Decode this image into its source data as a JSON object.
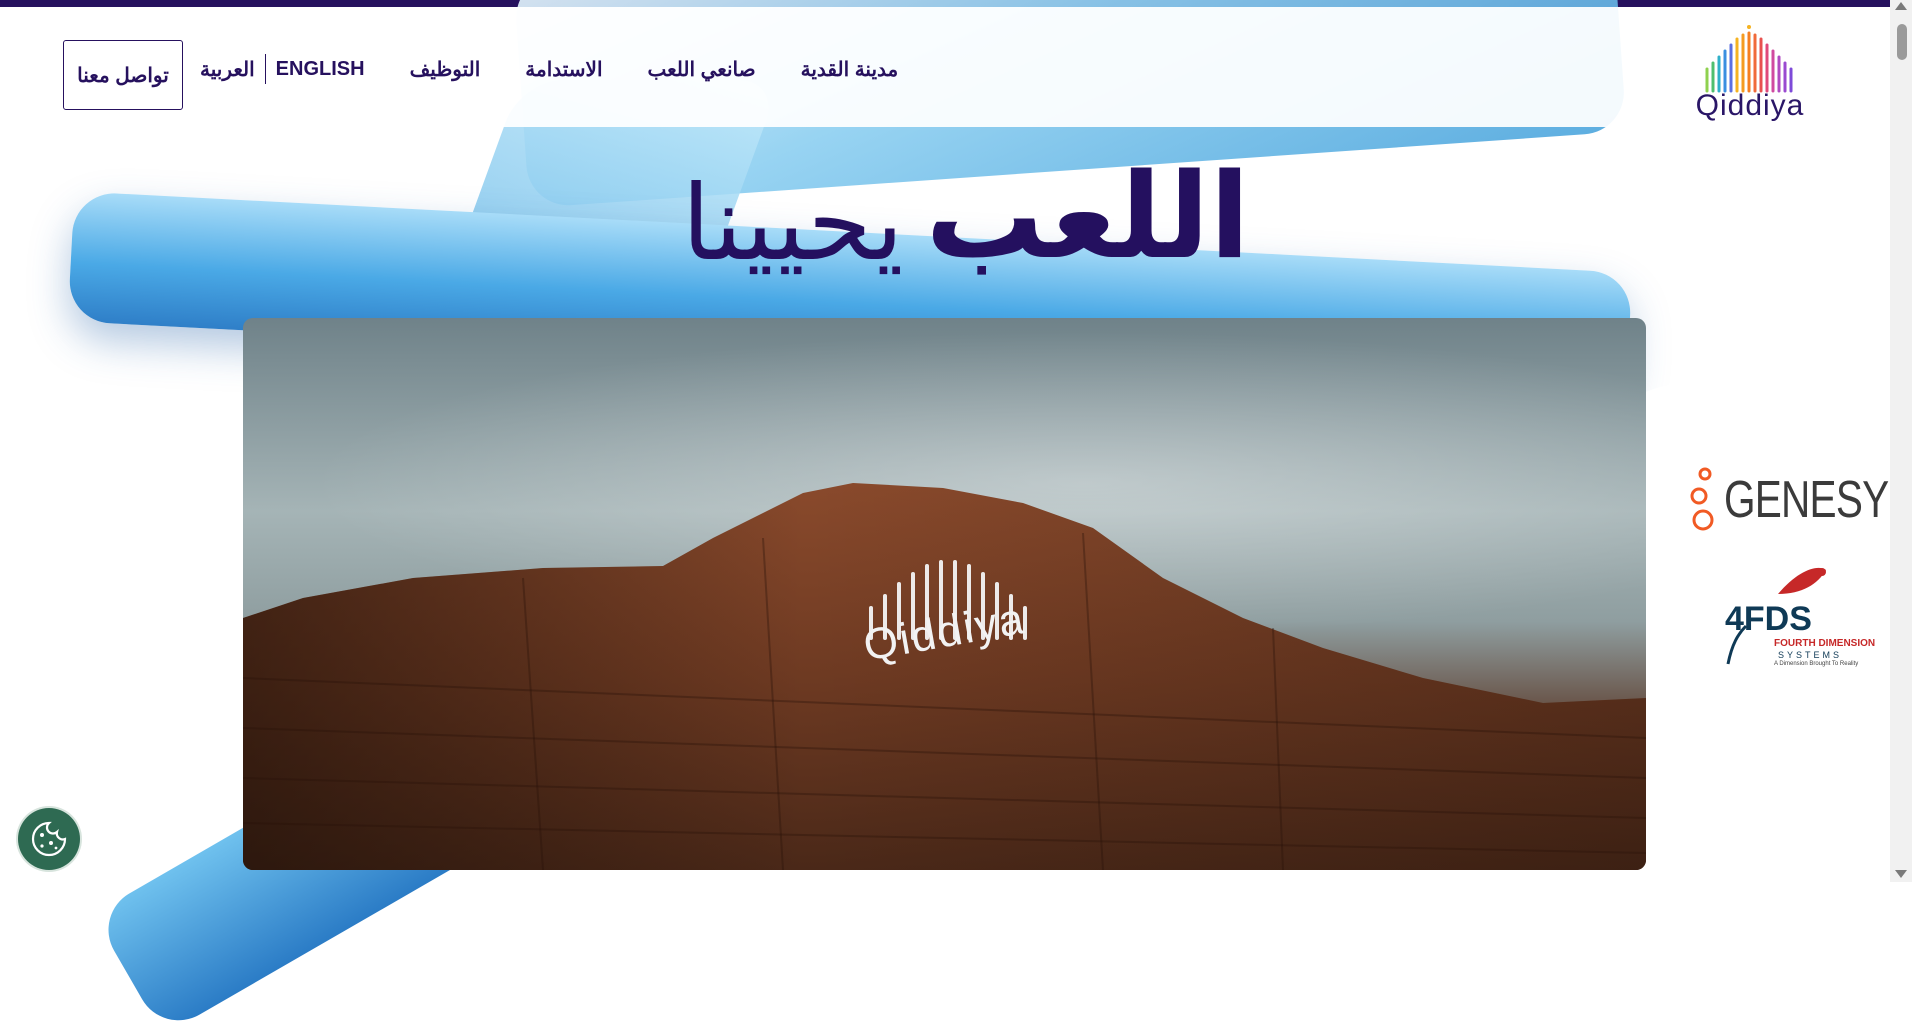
{
  "header": {
    "logo_text": "Qiddiya",
    "nav": [
      {
        "label": "مدينة القدية"
      },
      {
        "label": "صانعي اللعب"
      },
      {
        "label": "الاستدامة"
      },
      {
        "label": "التوظيف"
      }
    ],
    "lang": {
      "english": "ENGLISH",
      "arabic": "العربية"
    },
    "contact_label": "تواصل معنا"
  },
  "hero": {
    "title_bold": "اللعب",
    "title_light": "يحيينا"
  },
  "video": {
    "logo_text": "Qiddiya"
  },
  "sponsors": {
    "genesys": "GENESYS",
    "fds_brand": "4FDS",
    "fds_name": "FOURTH DIMENSION",
    "fds_systems": "SYSTEMS",
    "fds_tagline": "A Dimension Brought To Reality"
  },
  "colors": {
    "brand": "#26115e",
    "accent_blue": "#4aa9e6",
    "cookie_bg": "#2e6a52"
  },
  "icons": {
    "cookie": "cookie-icon"
  }
}
